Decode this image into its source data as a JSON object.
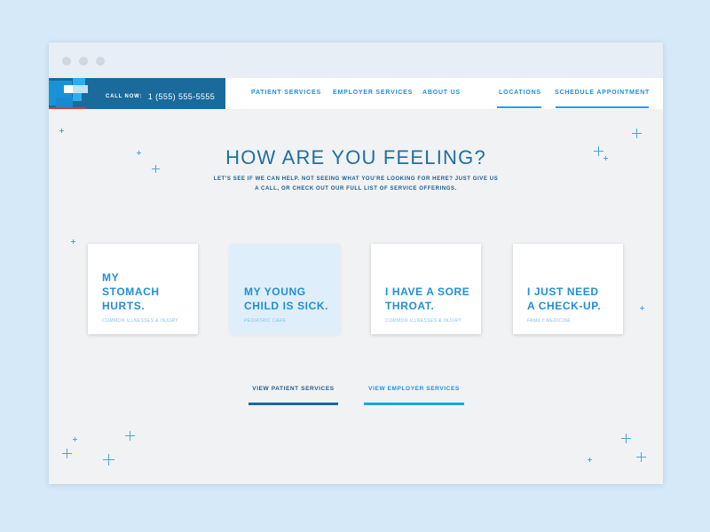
{
  "header": {
    "call_label": "CALL NOW:",
    "phone": "1 (555) 555-5555",
    "nav": [
      {
        "label": "PATIENT SERVICES"
      },
      {
        "label": "EMPLOYER SERVICES"
      },
      {
        "label": "ABOUT US"
      },
      {
        "label": "LOCATIONS"
      },
      {
        "label": "SCHEDULE APPOINTMENT"
      }
    ]
  },
  "hero": {
    "title": "HOW ARE YOU FEELING?",
    "subtitle_line1": "LET'S SEE IF WE CAN HELP. NOT SEEING WHAT YOU'RE LOOKING FOR HERE? JUST GIVE US",
    "subtitle_line2": "A CALL, OR CHECK OUT OUR FULL LIST OF SERVICE OFFERINGS."
  },
  "cards": [
    {
      "line1": "MY",
      "line2": "STOMACH",
      "line3": "HURTS.",
      "tag": "COMMON ILLNESSES & INJURY",
      "active": false
    },
    {
      "line1": "MY YOUNG",
      "line2": "CHILD IS SICK.",
      "tag": "PEDIATRIC CARE",
      "active": true
    },
    {
      "line1": "I HAVE A SORE",
      "line2": "THROAT.",
      "tag": "COMMON ILLNESSES & INJURY",
      "active": false
    },
    {
      "line1": "I JUST NEED",
      "line2": "A CHECK-UP.",
      "tag": "FAMILY MEDICINE",
      "active": false
    }
  ],
  "buttons": {
    "patient": "VIEW PATIENT SERVICES",
    "employer": "VIEW EMPLOYER SERVICES"
  },
  "colors": {
    "brand_dark": "#1a6a9b",
    "accent": "#1ea1e6",
    "background": "#f1f2f4",
    "page_bg": "#d6e9f8",
    "logo_red": "#d43a3a"
  },
  "icons": {
    "logo": "medical-cross-logo",
    "window_controls": "window-dot",
    "decorations": "plus-sparkle"
  }
}
